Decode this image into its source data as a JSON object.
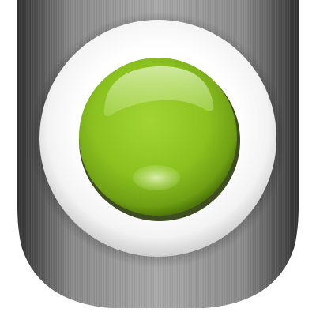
{
  "app_icon": {
    "icon_name": "green-power-button-icon",
    "colors": {
      "casing_dark": "#3c3c3c",
      "casing_mid": "#8e8e8e",
      "casing_light": "#d8d8d8",
      "ring": "#ffffff",
      "button_green": "#8cc31e",
      "button_green_dark": "#5e8f0f",
      "button_highlight": "#c9e58a",
      "background": "#ffffff"
    }
  }
}
